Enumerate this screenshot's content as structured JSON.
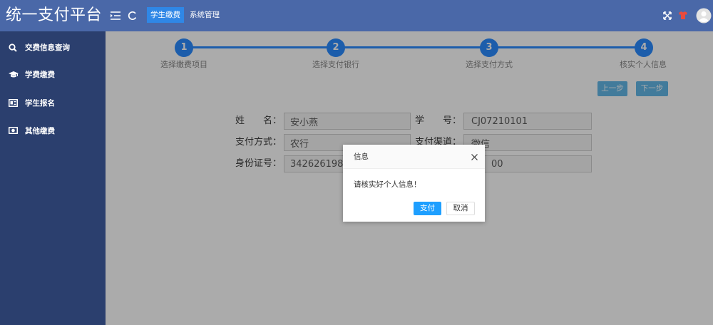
{
  "app": {
    "title": "统一支付平台"
  },
  "header": {
    "tabs": [
      {
        "label": "学生缴费",
        "active": true
      },
      {
        "label": "系统管理",
        "active": false
      }
    ],
    "icons": {
      "menu": "menu-toggle-icon",
      "refresh": "refresh-icon",
      "fullscreen": "fullscreen-icon",
      "theme": "theme-shirt-icon",
      "user": "avatar-icon"
    }
  },
  "sidebar": {
    "items": [
      {
        "label": "交费信息查询",
        "icon": "search-icon"
      },
      {
        "label": "学费缴费",
        "icon": "graduation-cap-icon"
      },
      {
        "label": "学生报名",
        "icon": "id-card-icon"
      },
      {
        "label": "其他缴费",
        "icon": "money-icon"
      }
    ]
  },
  "steps": [
    {
      "number": "1",
      "label": "选择缴费项目"
    },
    {
      "number": "2",
      "label": "选择支付银行"
    },
    {
      "number": "3",
      "label": "选择支付方式"
    },
    {
      "number": "4",
      "label": "核实个人信息"
    }
  ],
  "nav_buttons": {
    "prev": "上一步",
    "next": "下一步"
  },
  "form": {
    "name": {
      "label": "姓　　名：",
      "value": "安小燕"
    },
    "student_id": {
      "label": "学　　号：",
      "value": "CJ07210101"
    },
    "payment_method": {
      "label": "支付方式：",
      "value": "农行"
    },
    "payment_channel": {
      "label": "支付渠道：",
      "value": "微信"
    },
    "id_number": {
      "label": "身份证号：",
      "value": "3426261980"
    },
    "hidden_field": {
      "value": "00"
    }
  },
  "dialog": {
    "title": "信息",
    "message": "请核实好个人信息！",
    "confirm": "支付",
    "cancel": "取消",
    "close_icon": "close-icon"
  },
  "colors": {
    "header": "#4a68a8",
    "sidebar": "#2b3f6e",
    "tab_active": "#2f87e6",
    "step": "#2a8bff",
    "nav_button": "#63b8e8",
    "confirm_button": "#1e9fff",
    "theme_icon": "#e84b3c"
  }
}
